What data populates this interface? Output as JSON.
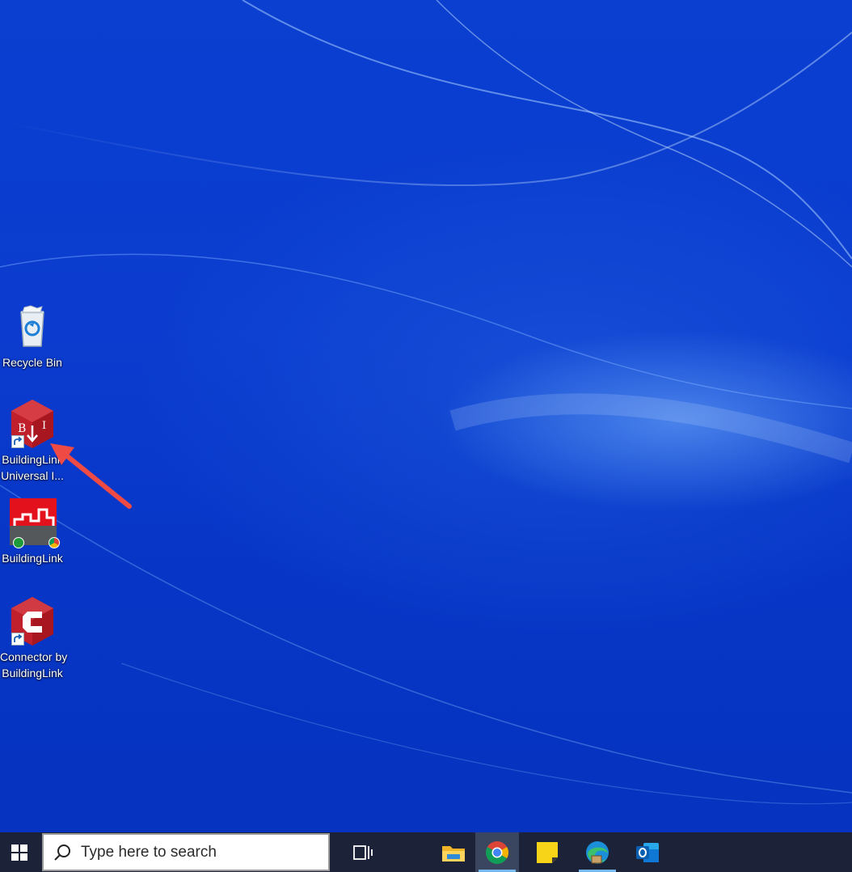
{
  "desktop": {
    "icons": [
      {
        "label": "Recycle Bin",
        "icon": "recycle-bin-icon"
      },
      {
        "label": "BuildingLink Universal I...",
        "line1": "BuildingLink",
        "line2": "Universal I...",
        "icon": "buildinglink-universal-installer-icon"
      },
      {
        "label": "BuildingLink",
        "icon": "buildinglink-app-icon"
      },
      {
        "label": "Connector by BuildingLink",
        "line1": "Connector by",
        "line2": "BuildingLink",
        "icon": "connector-buildinglink-icon"
      }
    ],
    "annotation": {
      "type": "arrow",
      "color": "#f04a44",
      "target": "BuildingLink Universal I..."
    }
  },
  "taskbar": {
    "search_placeholder": "Type here to search",
    "items": [
      {
        "name": "task-view",
        "icon": "task-view-icon"
      },
      {
        "name": "file-explorer",
        "icon": "folder-icon"
      },
      {
        "name": "chrome",
        "icon": "chrome-icon",
        "state": "active"
      },
      {
        "name": "sticky-notes",
        "icon": "sticky-notes-icon"
      },
      {
        "name": "edge",
        "icon": "edge-icon"
      },
      {
        "name": "outlook",
        "icon": "outlook-icon"
      }
    ]
  },
  "colors": {
    "wallpaper": "#0b3ccf",
    "taskbar": "#1c2238",
    "accent_underline": "#77b9ee",
    "arrow": "#f04a44"
  }
}
